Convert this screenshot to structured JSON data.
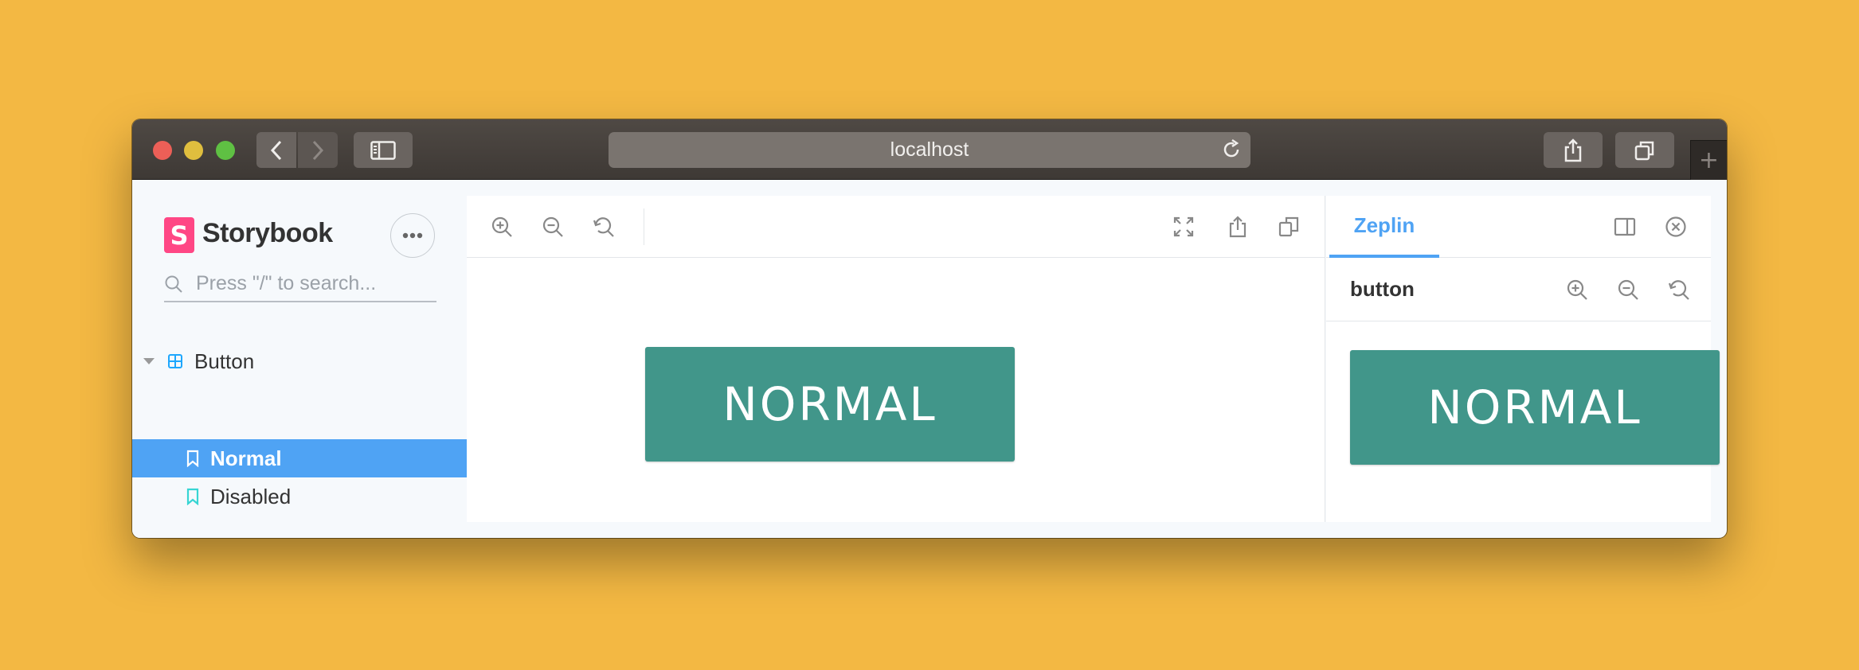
{
  "browser": {
    "url": "localhost",
    "new_tab_label": "+"
  },
  "sidebar": {
    "logo_mark": "S",
    "brand": "Storybook",
    "search_placeholder": "Press \"/\" to search...",
    "group": {
      "label": "Button"
    },
    "stories": [
      {
        "label": "Normal",
        "active": true
      },
      {
        "label": "Disabled",
        "active": false
      }
    ]
  },
  "canvas": {
    "button_label": "NORMAL"
  },
  "addon": {
    "tab_label": "Zeplin",
    "component_name": "button",
    "button_label": "NORMAL"
  },
  "colors": {
    "background": "#F3B843",
    "accent": "#4FA3F4",
    "storybook_pink": "#FF4785",
    "button_teal": "#41968A"
  }
}
